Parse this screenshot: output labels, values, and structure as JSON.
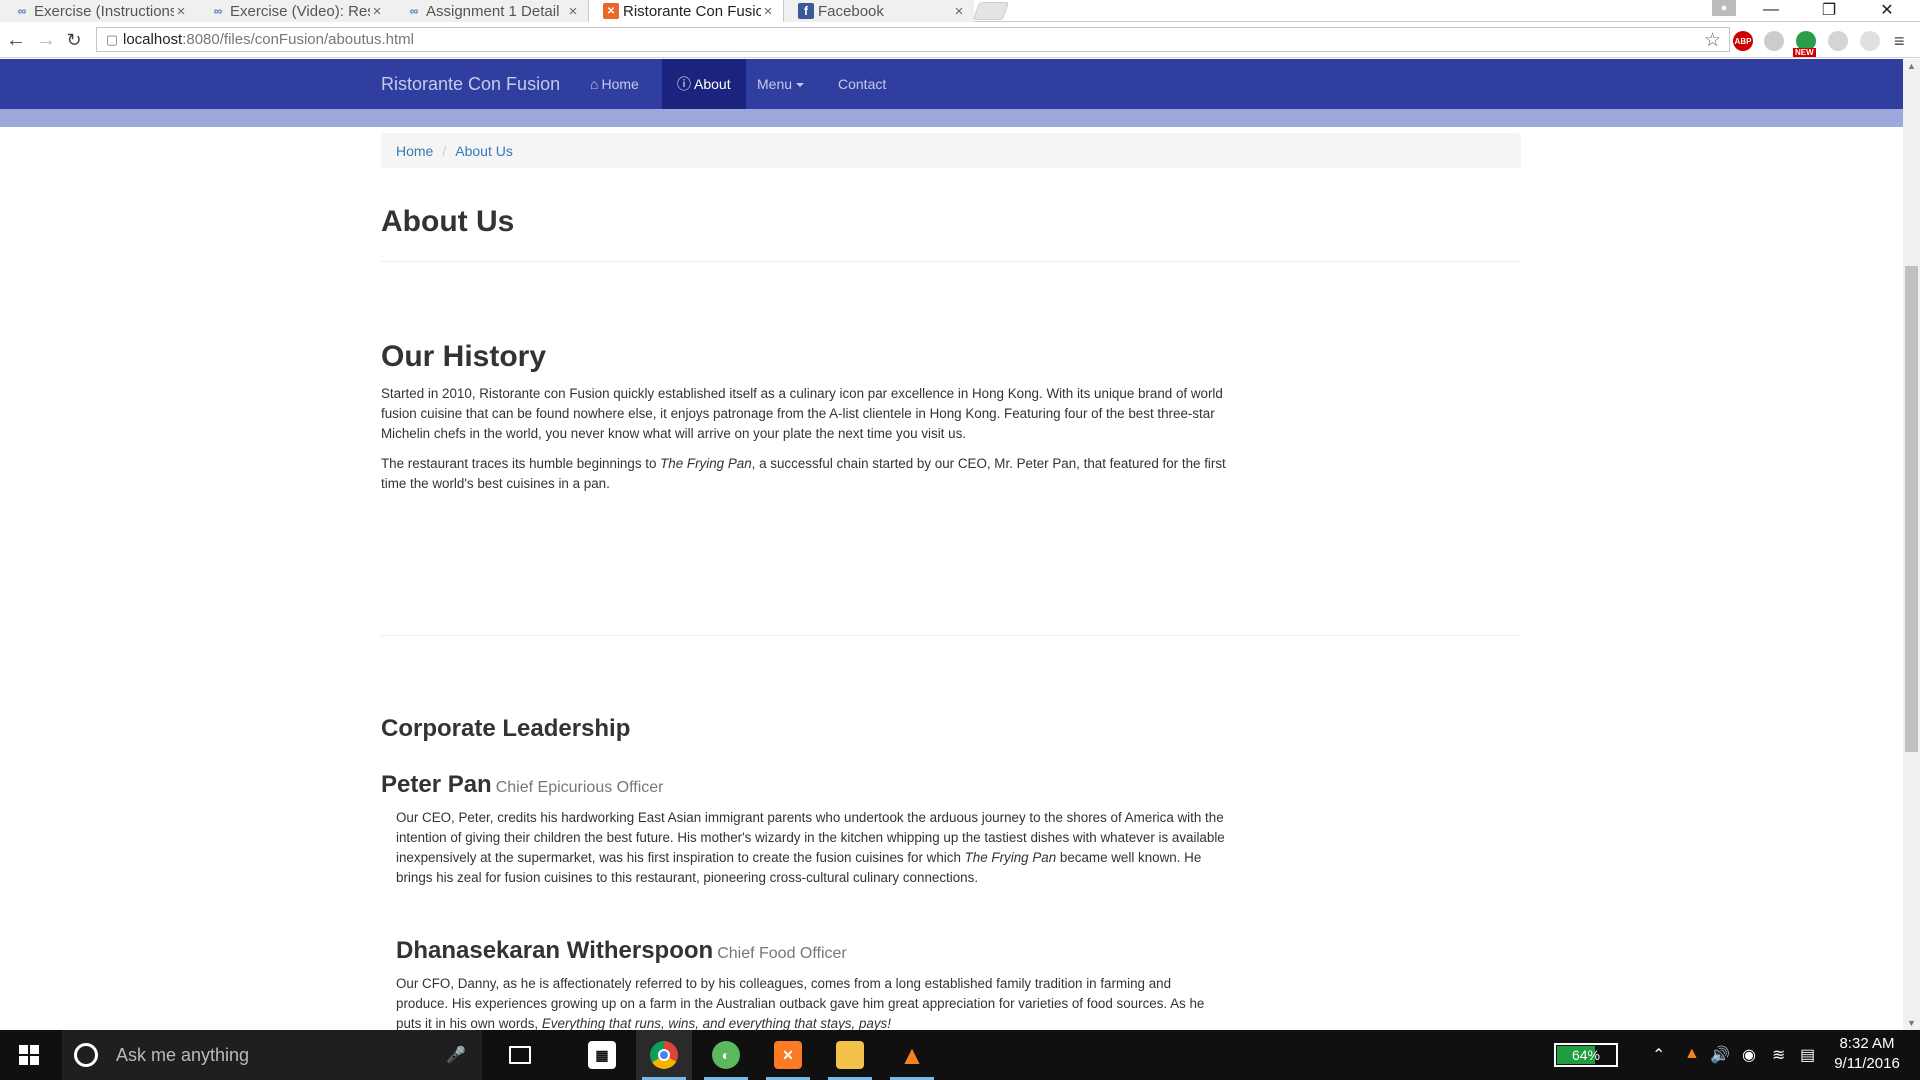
{
  "browser": {
    "tabs": [
      {
        "title": "Exercise (Instructions",
        "icon": "coursera-icon",
        "active": false
      },
      {
        "title": "Exercise (Video): Res",
        "icon": "coursera-icon",
        "active": false
      },
      {
        "title": "Assignment 1 Detail",
        "icon": "coursera-icon",
        "active": false
      },
      {
        "title": "Ristorante Con Fusio",
        "icon": "xampp-icon",
        "active": true
      },
      {
        "title": "Facebook",
        "icon": "facebook-icon",
        "active": false
      }
    ],
    "url_host": "localhost",
    "url_path": ":8080/files/conFusion/aboutus.html",
    "extensions": {
      "abp": "ABP",
      "new_badge": "NEW"
    }
  },
  "navbar": {
    "brand": "Ristorante Con Fusion",
    "items": [
      {
        "label": "Home",
        "icon": "home-icon"
      },
      {
        "label": "About",
        "icon": "info-icon"
      },
      {
        "label": "Menu",
        "icon": "caret-down-icon"
      },
      {
        "label": "Contact"
      }
    ],
    "colors": {
      "bar": "#303f9f",
      "active": "#1a237e",
      "jumbotron": "#9fa8da"
    }
  },
  "breadcrumb": [
    "Home",
    "About Us"
  ],
  "page_title": "About Us",
  "history": {
    "title": "Our History",
    "p1": "Started in 2010, Ristorante con Fusion quickly established itself as a culinary icon par excellence in Hong Kong. With its unique brand of world fusion cuisine that can be found nowhere else, it enjoys patronage from the A-list clientele in Hong Kong. Featuring four of the best three-star Michelin chefs in the world, you never know what will arrive on your plate the next time you visit us.",
    "p2_before": "The restaurant traces its humble beginnings to ",
    "p2_em": "The Frying Pan",
    "p2_after": ", a successful chain started by our CEO, Mr. Peter Pan, that featured for the first time the world's best cuisines in a pan."
  },
  "leadership": {
    "title": "Corporate Leadership",
    "people": [
      {
        "name": "Peter Pan",
        "role": "Chief Epicurious Officer",
        "bio_before": "Our CEO, Peter, credits his hardworking East Asian immigrant parents who undertook the arduous journey to the shores of America with the intention of giving their children the best future. His mother's wizardy in the kitchen whipping up the tastiest dishes with whatever is available inexpensively at the supermarket, was his first inspiration to create the fusion cuisines for which ",
        "bio_em": "The Frying Pan",
        "bio_after": " became well known. He brings his zeal for fusion cuisines to this restaurant, pioneering cross-cultural culinary connections."
      },
      {
        "name": "Dhanasekaran Witherspoon",
        "role": "Chief Food Officer",
        "bio_before": "Our CFO, Danny, as he is affectionately referred to by his colleagues, comes from a long established family tradition in farming and produce. His experiences growing up on a farm in the Australian outback gave him great appreciation for varieties of food sources. As he puts it in his own words, ",
        "bio_em": "Everything that runs, wins, and everything that stays, pays!",
        "bio_after": ""
      }
    ]
  },
  "taskbar": {
    "search_placeholder": "Ask me anything",
    "battery": "64%",
    "time": "8:32 AM",
    "date": "9/11/2016"
  }
}
